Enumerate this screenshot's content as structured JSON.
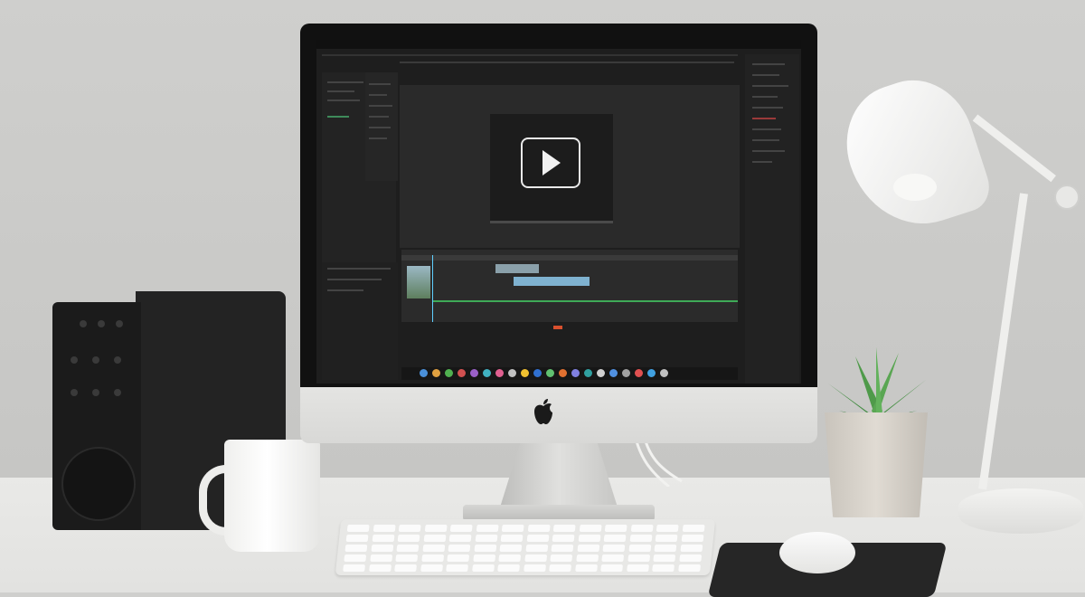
{
  "scene": {
    "description_tags": [
      "desk",
      "computer",
      "lamp",
      "plant"
    ],
    "colors": {
      "wall": "#cbcbc9",
      "desk": "#e6e6e4",
      "screen_bg": "#1e1e1e",
      "timeline_green": "#3faa57",
      "timeline_blue": "#7fb2d0",
      "play_icon": "#f1f1f1"
    }
  },
  "screen": {
    "icons": {
      "play": "play-button-icon",
      "apple": "apple-logo-icon"
    }
  }
}
